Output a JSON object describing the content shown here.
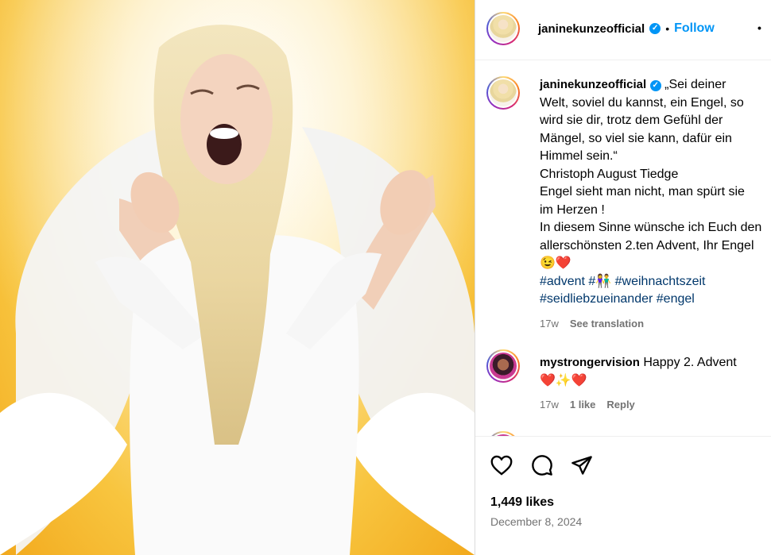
{
  "post": {
    "author": "janinekunzeofficial",
    "follow_label": "Follow",
    "separator": "•",
    "more_label": "•",
    "caption_lines": [
      "„Sei deiner",
      "Welt, soviel du kannst, ein Engel, so",
      "wird sie dir, trotz dem Gefühl der",
      "Mängel, so viel sie kann, dafür ein",
      "Himmel sein.“",
      "Christoph August Tiedge",
      "Engel sieht man nicht, man spürt sie",
      "im Herzen !",
      "In diesem Sinne wünsche ich Euch den",
      "allerschönsten 2.ten Advent, Ihr Engel",
      "😉❤️"
    ],
    "hashtags_line1": "#advent #👫 #weihnachtszeit",
    "hashtags_line2": "#seidliebzueinander #engel",
    "caption_age": "17w",
    "see_translation": "See translation",
    "likes": "1,449 likes",
    "date": "December 8, 2024"
  },
  "comments": [
    {
      "author": "mystrongervision",
      "text": "Happy 2. Advent",
      "emoji_line": "❤️✨❤️",
      "age": "17w",
      "likes": "1 like",
      "reply": "Reply"
    }
  ],
  "icons": {
    "like": "heart-icon",
    "comment": "comment-icon",
    "share": "share-icon",
    "verified": "verified-icon"
  },
  "colors": {
    "accent": "#0095f6",
    "hashtag": "#00376b",
    "muted": "#737373"
  }
}
